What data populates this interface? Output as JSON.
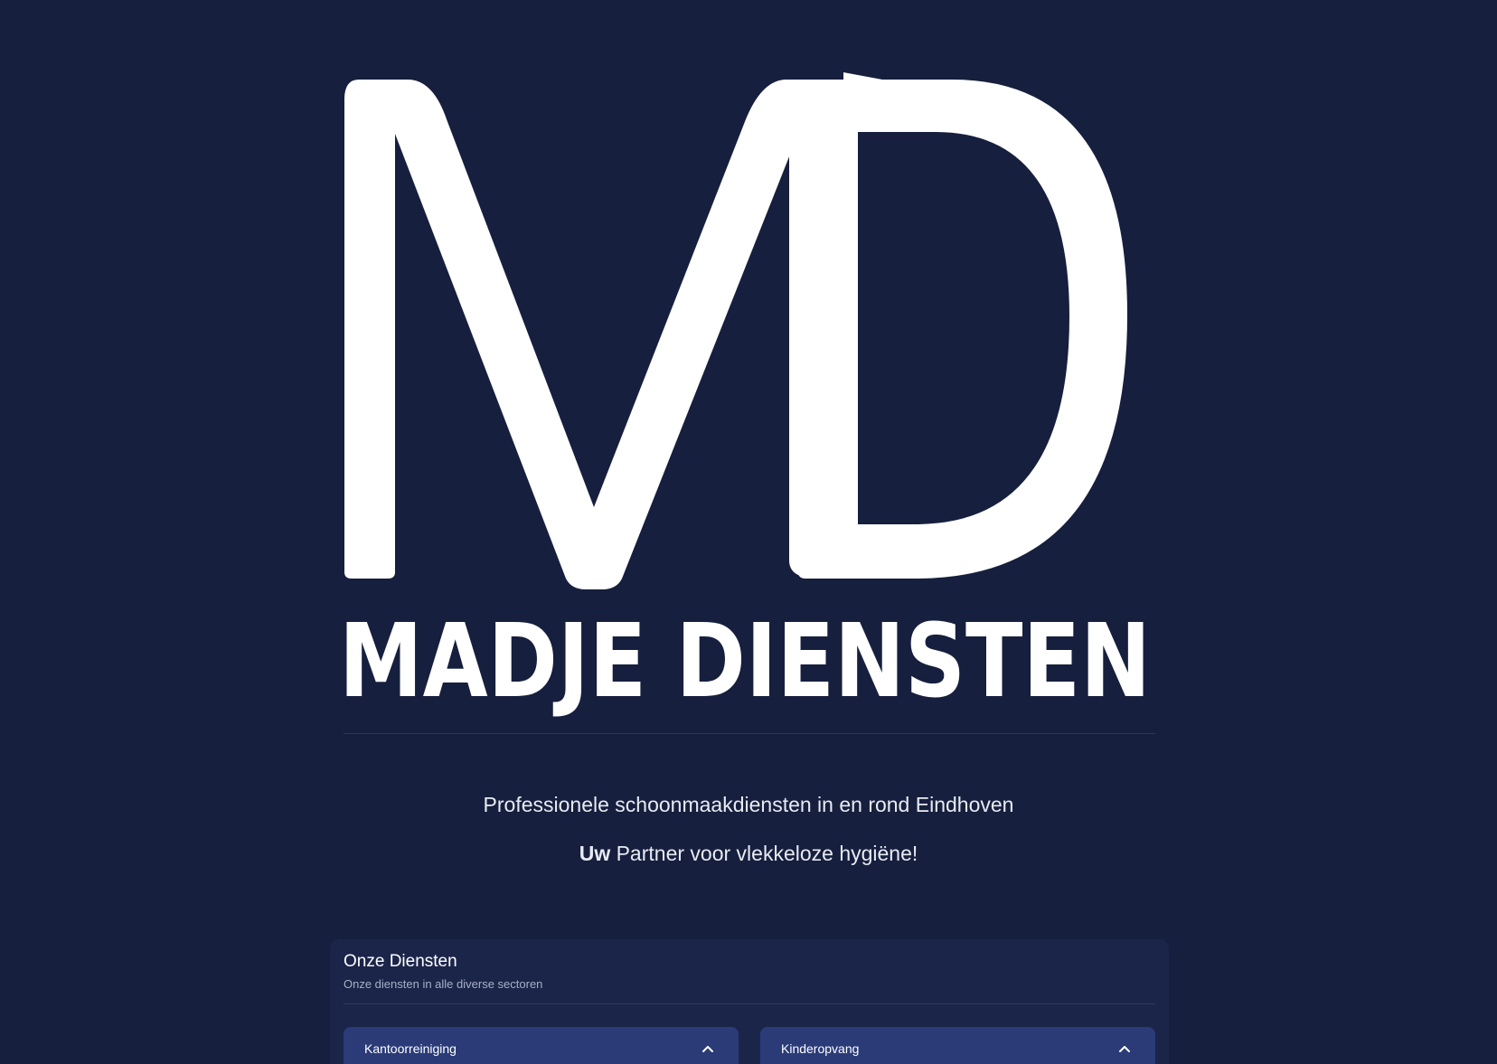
{
  "brand": {
    "logo_monogram": "MD",
    "logo_wordmark": "MADJE DIENSTEN"
  },
  "hero": {
    "tagline": "Professionele schoonmaakdiensten in en rond Eindhoven",
    "subtagline_bold": "Uw",
    "subtagline_rest": " Partner voor vlekkeloze hygiëne!"
  },
  "services": {
    "title": "Onze Diensten",
    "subtitle": "Onze diensten in alle diverse sectoren",
    "items": [
      {
        "label": "Kantoorreiniging",
        "icon": "chevron-up-icon"
      },
      {
        "label": "Kinderopvang",
        "icon": "chevron-up-icon"
      }
    ]
  },
  "colors": {
    "background": "#161f3d",
    "card": "#1b2549",
    "accordion": "#2a3b78",
    "text": "#ffffff"
  }
}
